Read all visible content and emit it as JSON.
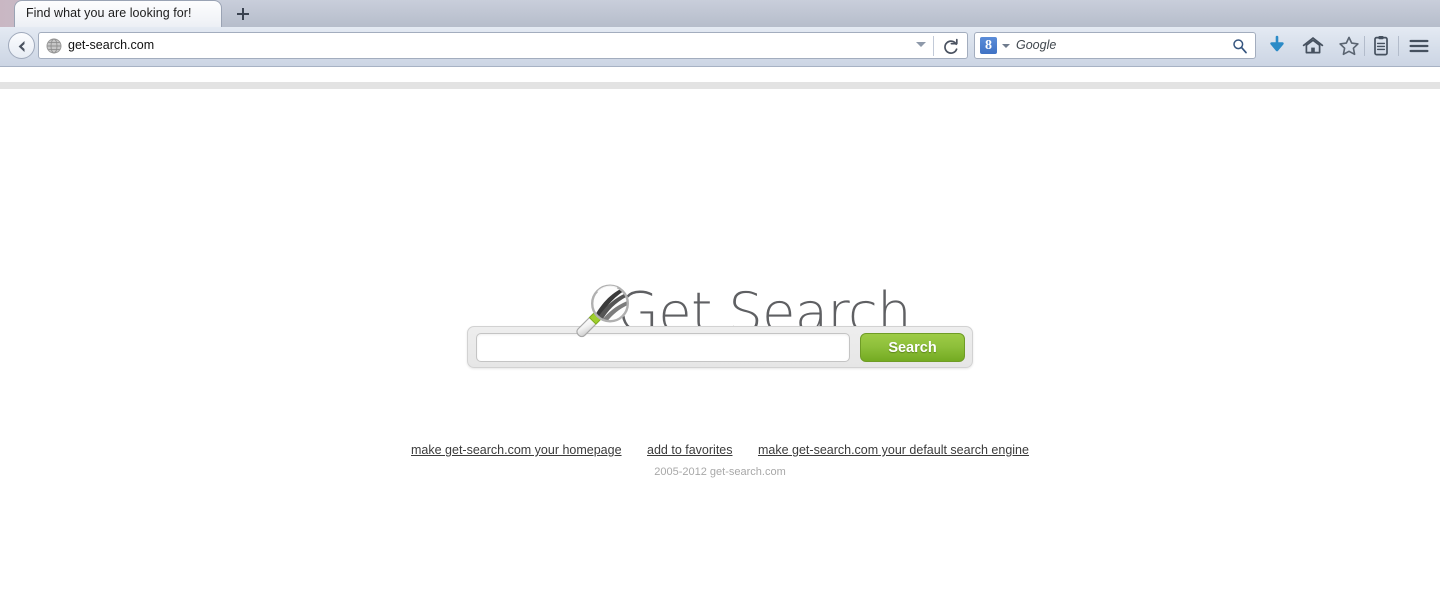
{
  "browser": {
    "tab": {
      "title": "Find what you are looking for!",
      "new_tab_label": "+"
    },
    "address_bar": {
      "url": "get-search.com",
      "favicon_name": "globe-icon"
    },
    "search_field": {
      "engine_label": "8",
      "placeholder": "Google"
    },
    "toolbar_icons": [
      "download-icon",
      "home-icon",
      "bookmark-star-icon",
      "reading-list-icon",
      "menu-icon"
    ]
  },
  "page": {
    "logo": {
      "text": "Get Search",
      "icon_name": "magnifying-glass-logo"
    },
    "search": {
      "value": "",
      "placeholder": "",
      "button_label": "Search"
    },
    "footer": {
      "links": [
        {
          "label": "make get-search.com your homepage"
        },
        {
          "label": "add to favorites"
        },
        {
          "label": "make get-search.com your default search engine"
        }
      ],
      "copyright": "2005-2012 get-search.com"
    }
  },
  "colors": {
    "accent_green": "#8ec03b",
    "green_dark": "#74ab22",
    "logo_grey": "#5f6063",
    "download_blue": "#2b8bc7",
    "google_blue": "#4276c4"
  }
}
